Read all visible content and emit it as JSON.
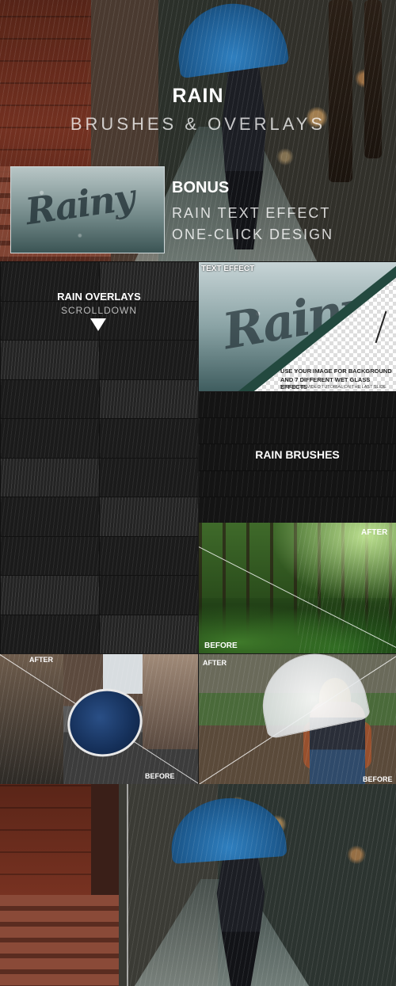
{
  "hero": {
    "title": "RAIN",
    "subtitle": "BRUSHES & OVERLAYS",
    "bonus_title": "BONUS",
    "bonus_line1": "RAIN TEXT EFFECT",
    "bonus_line2": "ONE-CLICK DESIGN",
    "bonus_word": "Rainy"
  },
  "overlays": {
    "title": "RAIN OVERLAYS",
    "subtitle": "SCROLLDOWN",
    "tile_count": 20
  },
  "text_effect": {
    "label": "TEXT EFFECT",
    "word": "Rainy",
    "note_line1": "USE YOUR IMAGE FOR BACKGROUND",
    "note_line2": "AND 7 DIFFERENT WET GLASS EFFECTS",
    "note_line3": "WATCH THE VIDEO TUTORIAL ON THE LAST SLIDE"
  },
  "brushes": {
    "title": "RAIN BRUSHES",
    "strip_count": 5
  },
  "forest": {
    "after": "AFTER",
    "before": "BEFORE"
  },
  "street": {
    "after": "AFTER",
    "before": "BEFORE"
  },
  "girl": {
    "after": "AFTER",
    "before": "BEFORE"
  },
  "colors": {
    "umbrella_blue": "#1d5a8f",
    "brick": "#7a3322",
    "forest_green": "#2b4e1c"
  }
}
